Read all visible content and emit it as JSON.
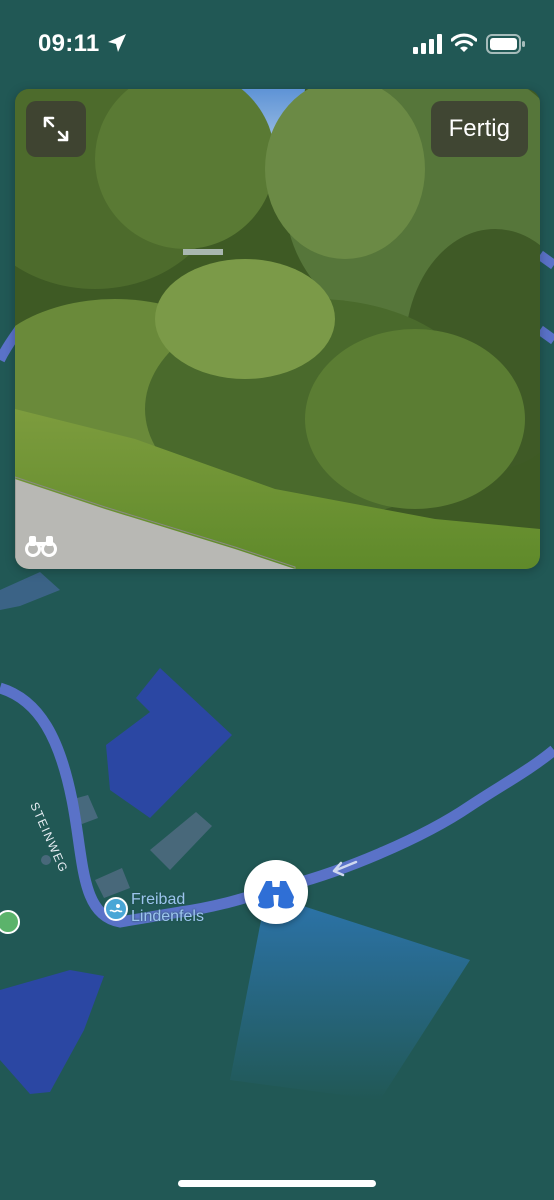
{
  "status_bar": {
    "time": "09:11",
    "location_icon": "location-arrow-icon",
    "signal_icon": "cellular-signal-icon",
    "wifi_icon": "wifi-icon",
    "battery_icon": "battery-icon"
  },
  "look_around": {
    "expand_icon": "expand-arrows-icon",
    "done_label": "Fertig",
    "binoculars_icon": "binoculars-icon"
  },
  "map": {
    "street_name": "STEINWEG",
    "poi_name_line1": "Freibad",
    "poi_name_line2": "Lindenfels",
    "poi_icon": "swimming-pool-icon",
    "viewer_icon": "binoculars-icon",
    "colors": {
      "map_background": "#215855",
      "road": "#5a72c8",
      "building_blue": "#2b4aa8",
      "accent_blue": "#2f6fd6"
    }
  }
}
